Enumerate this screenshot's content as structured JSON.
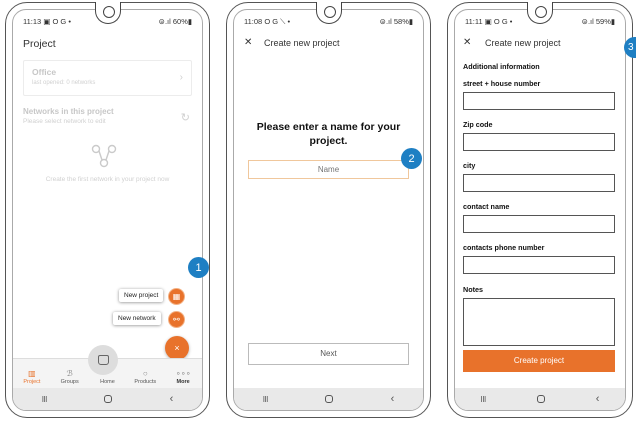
{
  "colors": {
    "accent": "#e8722b",
    "callout": "#1e7fc3"
  },
  "phone1": {
    "status": {
      "time": "11:13",
      "icons": "▣ O G •",
      "battery": "⊜.ıl 60%▮"
    },
    "title": "Project",
    "office": {
      "name": "Office",
      "subtitle": "last opened: 0 networks",
      "icon": "chevron-right-icon"
    },
    "networks_heading": "Networks in this project",
    "networks_sub": "Please select network to edit",
    "empty_text": "Create the first network in your project now",
    "fab": {
      "new_project": "New project",
      "new_network": "New network",
      "close": "×"
    },
    "tabs": [
      {
        "label": "Project",
        "icon": "project-icon"
      },
      {
        "label": "Groups",
        "icon": "groups-icon"
      },
      {
        "label": "Home",
        "icon": "home-icon"
      },
      {
        "label": "Products",
        "icon": "products-icon"
      },
      {
        "label": "More",
        "icon": "more-icon"
      }
    ],
    "callout": "1"
  },
  "phone2": {
    "status": {
      "time": "11:08",
      "icons": "O G ⟍ •",
      "battery": "⊜.ıl 58%▮"
    },
    "title": "Create new project",
    "prompt": "Please enter a name for your project.",
    "name_placeholder": "Name",
    "next": "Next",
    "callout": "2"
  },
  "phone3": {
    "status": {
      "time": "11:11",
      "icons": "▣ O G •",
      "battery": "⊜.ıl 59%▮"
    },
    "title": "Create new project",
    "section": "Additional information",
    "fields": [
      {
        "label": "street + house number",
        "value": ""
      },
      {
        "label": "Zip code",
        "value": ""
      },
      {
        "label": "city",
        "value": ""
      },
      {
        "label": "contact name",
        "value": ""
      },
      {
        "label": "contacts phone number",
        "value": ""
      },
      {
        "label": "Notes",
        "value": ""
      }
    ],
    "create": "Create project",
    "callout": "3"
  },
  "nav": {
    "recents": "III",
    "back": "‹"
  }
}
